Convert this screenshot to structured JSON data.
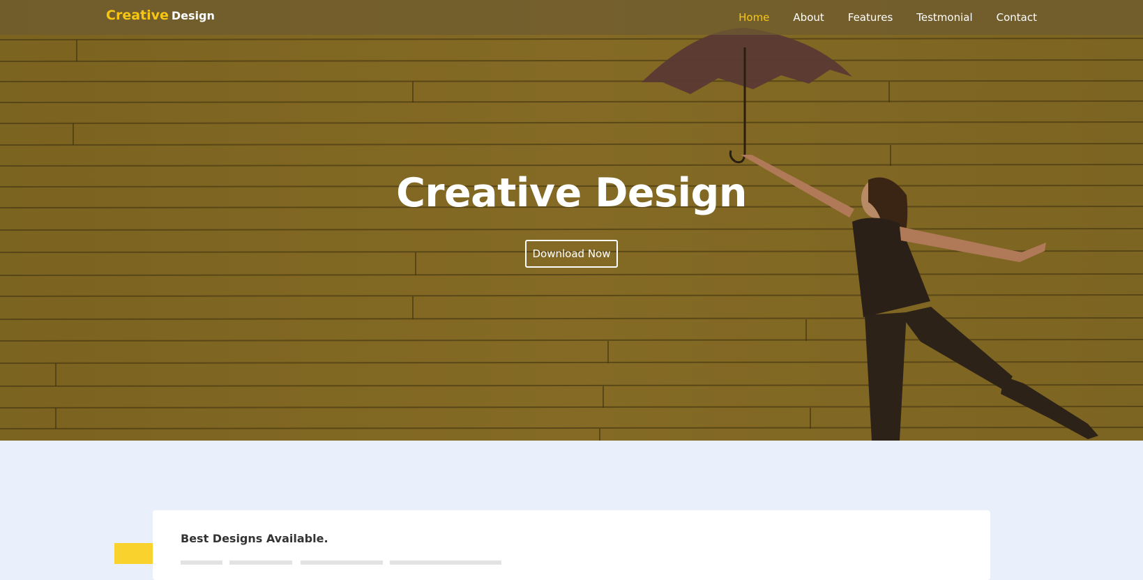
{
  "colors": {
    "accent": "#f7c615",
    "hero_overlay": "#7e6623",
    "navbar_bg": "#6e5c30",
    "lower_bg": "#e9effb",
    "card_bg": "#ffffff",
    "yellow_block": "#f9d22e"
  },
  "brand": {
    "accent_word": "Creative",
    "rest_word": "Design"
  },
  "nav": {
    "items": [
      {
        "label": "Home",
        "active": true
      },
      {
        "label": "About",
        "active": false
      },
      {
        "label": "Features",
        "active": false
      },
      {
        "label": "Testmonial",
        "active": false
      },
      {
        "label": "Contact",
        "active": false
      }
    ]
  },
  "hero": {
    "title": "Creative Design",
    "button_label": "Download Now",
    "image_subject": "woman-with-umbrella-photo"
  },
  "features": {
    "card_title": "Best Designs Available."
  }
}
